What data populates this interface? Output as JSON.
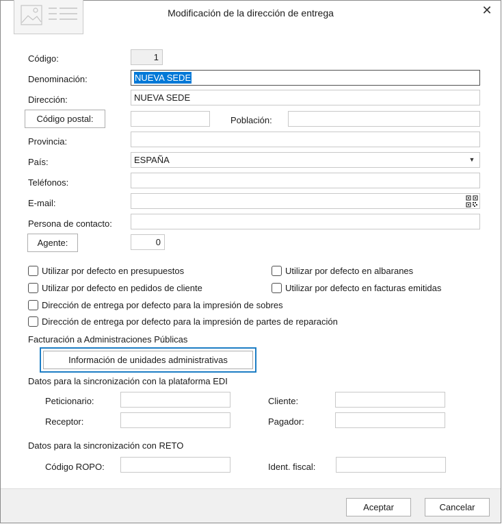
{
  "dialog": {
    "title": "Modificación de la dirección de entrega",
    "close_label": "✕"
  },
  "form": {
    "codigo": {
      "label": "Código:",
      "value": "1"
    },
    "denominacion": {
      "label": "Denominación:",
      "value": "NUEVA SEDE"
    },
    "direccion": {
      "label": "Dirección:",
      "value": "NUEVA SEDE"
    },
    "codigo_postal": {
      "button_label": "Código postal:",
      "value": ""
    },
    "poblacion": {
      "label": "Población:",
      "value": ""
    },
    "provincia": {
      "label": "Provincia:",
      "value": ""
    },
    "pais": {
      "label": "País:",
      "value": "ESPAÑA",
      "arrow": "▼"
    },
    "telefonos": {
      "label": "Teléfonos:",
      "value": ""
    },
    "email": {
      "label": "E-mail:",
      "value": ""
    },
    "persona_contacto": {
      "label": "Persona de contacto:",
      "value": ""
    },
    "agente": {
      "button_label": "Agente:",
      "value": "0"
    }
  },
  "checkboxes": {
    "presupuestos": "Utilizar por defecto en presupuestos",
    "albaranes": "Utilizar por defecto en albaranes",
    "pedidos": "Utilizar por defecto en pedidos de cliente",
    "facturas": "Utilizar por defecto en facturas emitidas",
    "sobres": "Dirección de entrega por defecto para la impresión de sobres",
    "partes": "Dirección de entrega por defecto para la impresión de partes de reparación"
  },
  "administraciones": {
    "heading": "Facturación a Administraciones Públicas",
    "button_label": "Información de unidades administrativas"
  },
  "edi": {
    "heading": "Datos para la sincronización con la plataforma EDI",
    "peticionario": "Peticionario:",
    "cliente": "Cliente:",
    "receptor": "Receptor:",
    "pagador": "Pagador:"
  },
  "reto": {
    "heading": "Datos para la sincronización con RETO",
    "codigo_ropo": "Código ROPO:",
    "ident_fiscal": "Ident. fiscal:"
  },
  "footer": {
    "accept_label": "Aceptar",
    "cancel_label": "Cancelar"
  }
}
